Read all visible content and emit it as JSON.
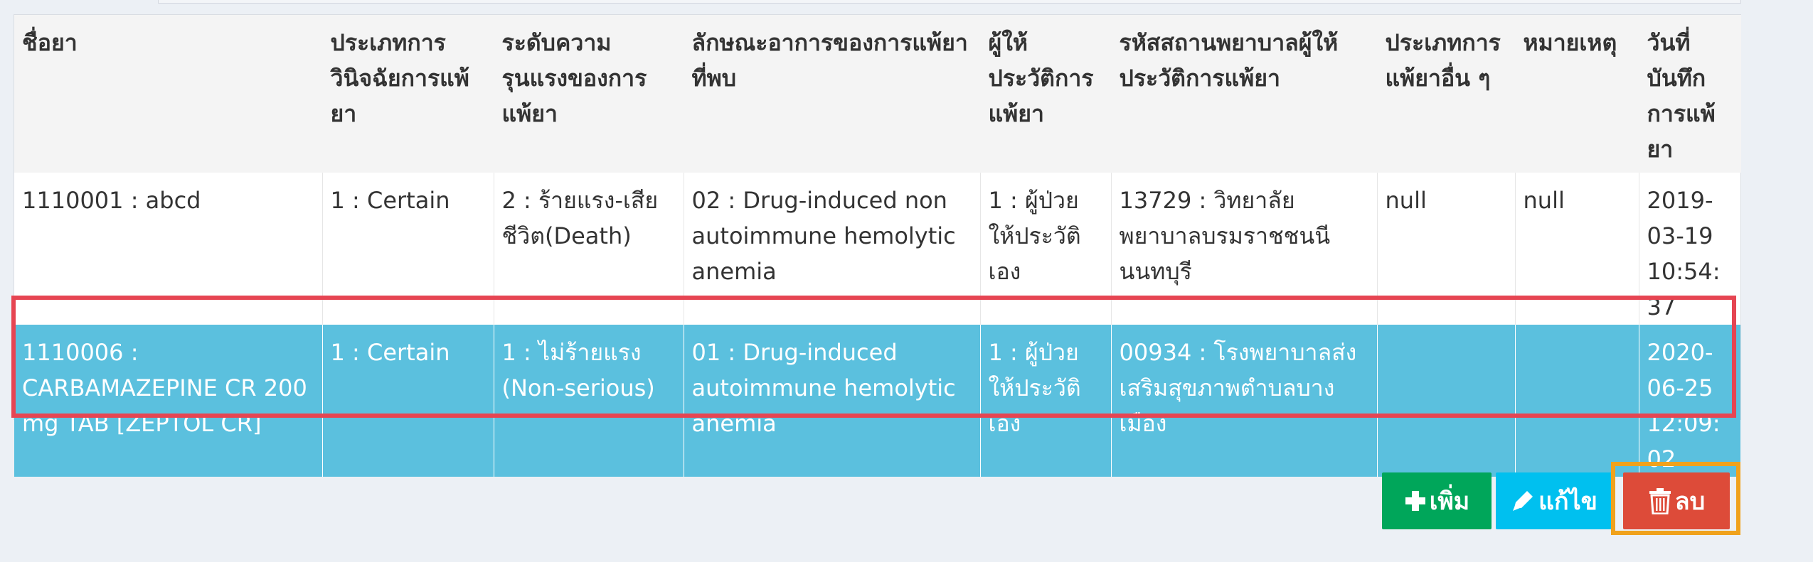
{
  "table": {
    "headers": [
      "ชื่อยา",
      "ประเภทการวินิจฉัยการแพ้ยา",
      "ระดับความรุนแรงของการแพ้ยา",
      "ลักษณะอาการของการแพ้ยาที่พบ",
      "ผู้ให้ประวัติการแพ้ยา",
      "รหัสสถานพยาบาลผู้ให้ประวัติการแพ้ยา",
      "ประเภทการแพ้ยาอื่น ๆ",
      "หมายเหตุ",
      "วันที่บันทึกการแพ้ยา"
    ],
    "rows": [
      [
        "1110001 : abcd",
        "1 : Certain",
        "2 : ร้ายแรง-เสียชีวิต(Death)",
        "02 : Drug-induced non autoimmune hemolytic anemia",
        "1 : ผู้ป่วยให้ประวัติเอง",
        "13729 : วิทยาลัยพยาบาลบรมราชชนนีนนทบุรี",
        "null",
        "null",
        "2019-03-19 10:54:37"
      ],
      [
        "1110006 : CARBAMAZEPINE CR 200 mg TAB [ZEPTOL CR]",
        "1 : Certain",
        "1 : ไม่ร้ายแรง (Non-serious)",
        "01 : Drug-induced autoimmune hemolytic anemia",
        "1 : ผู้ป่วยให้ประวัติเอง",
        "00934 : โรงพยาบาลส่งเสริมสุขภาพตำบลบางเมือง",
        "",
        "",
        "2020-06-25 12:09:02"
      ]
    ]
  },
  "actions": {
    "add_label": "เพิ่ม",
    "edit_label": "แก้ไข",
    "delete_label": "ลบ"
  },
  "icons": {
    "add": "plus-icon",
    "edit": "pencil-icon",
    "delete": "trash-icon"
  },
  "colors": {
    "selected_row": "#5bc0de",
    "selected_outline": "#e64552",
    "add_button": "#00a65a",
    "edit_button": "#00c0ef",
    "delete_button": "#dd4b39",
    "delete_focus": "#f0a21c"
  }
}
